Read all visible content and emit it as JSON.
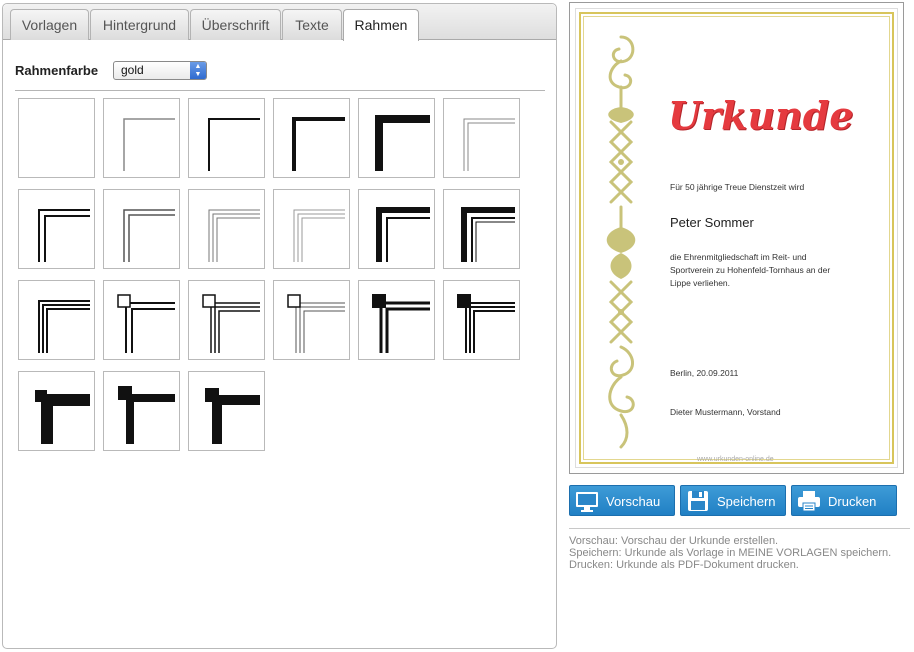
{
  "tabs": [
    {
      "label": "Vorlagen",
      "active": false
    },
    {
      "label": "Hintergrund",
      "active": false
    },
    {
      "label": "Überschrift",
      "active": false
    },
    {
      "label": "Texte",
      "active": false
    },
    {
      "label": "Rahmen",
      "active": true
    }
  ],
  "frame_color": {
    "label": "Rahmenfarbe",
    "selected": "gold"
  },
  "frame_styles": [
    "none",
    "thin-gray",
    "thin-black",
    "medium-black",
    "thick-black",
    "double-thin-gray",
    "double-black",
    "double-gray",
    "triple-gray",
    "triple-light",
    "double-thick-black",
    "thick-double-black",
    "triple-black",
    "square-corner-double",
    "square-corner-triple",
    "square-corner-light",
    "block-corner-double",
    "block-corner-triple",
    "heavy-corner",
    "heavy-block-corner",
    "heavy-square-corner"
  ],
  "certificate": {
    "title": "Urkunde",
    "intro": "Für 50 jährige Treue Dienstzeit wird",
    "name": "Peter Sommer",
    "body_lines": [
      "die Ehrenmitgliedschaft im Reit- und",
      "Sportverein zu Hohenfeld-Tornhaus an der",
      "Lippe verliehen."
    ],
    "place_date": "Berlin, 20.09.2011",
    "signer": "Dieter Mustermann, Vorstand",
    "footer_url": "www.urkunden-online.de",
    "frame_color_hex": "#d8c55c",
    "title_color_hex": "#e53a3f",
    "ornament_color_hex": "#c9c37a"
  },
  "actions": [
    {
      "label": "Vorschau",
      "icon": "monitor-icon"
    },
    {
      "label": "Speichern",
      "icon": "floppy-disk-icon"
    },
    {
      "label": "Drucken",
      "icon": "printer-icon"
    }
  ],
  "help": [
    "Vorschau: Vorschau der Urkunde erstellen.",
    "Speichern: Urkunde als Vorlage in MEINE VORLAGEN speichern.",
    "Drucken: Urkunde als PDF-Dokument drucken."
  ],
  "colors": {
    "button_blue": "#2b8bcc",
    "help_text": "#888888"
  }
}
